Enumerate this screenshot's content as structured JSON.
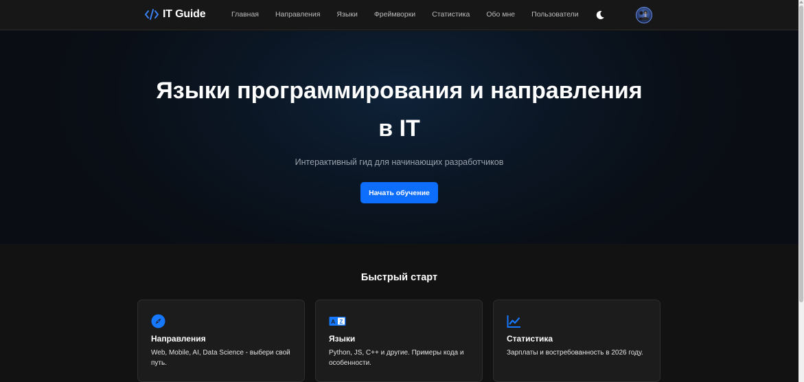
{
  "brand": {
    "name": "IT Guide",
    "icon": "code-icon"
  },
  "nav": {
    "links": [
      "Главная",
      "Направления",
      "Языки",
      "Фреймворки",
      "Статистика",
      "Обо мне",
      "Пользователи"
    ],
    "theme_icon": "moon-icon",
    "avatar_icon": "user-avatar"
  },
  "hero": {
    "title_line1": "Языки программирования и направления",
    "title_line2": "в IT",
    "subtitle": "Интерактивный гид для начинающих разработчиков",
    "cta_label": "Начать обучение"
  },
  "quickstart": {
    "title": "Быстрый старт",
    "cards": [
      {
        "icon": "compass-icon",
        "title": "Направления",
        "text": "Web, Mobile, AI, Data Science - выбери свой путь."
      },
      {
        "icon": "translate-icon",
        "title": "Языки",
        "text": "Python, JS, C++ и другие. Примеры кода и особенности."
      },
      {
        "icon": "chart-line-icon",
        "title": "Статистика",
        "text": "Зарплаты и востребованность в 2026 году."
      }
    ]
  },
  "colors": {
    "accent": "#0d6efd",
    "background": "#121212",
    "navbar": "#171717",
    "card": "#1c1c1c"
  }
}
